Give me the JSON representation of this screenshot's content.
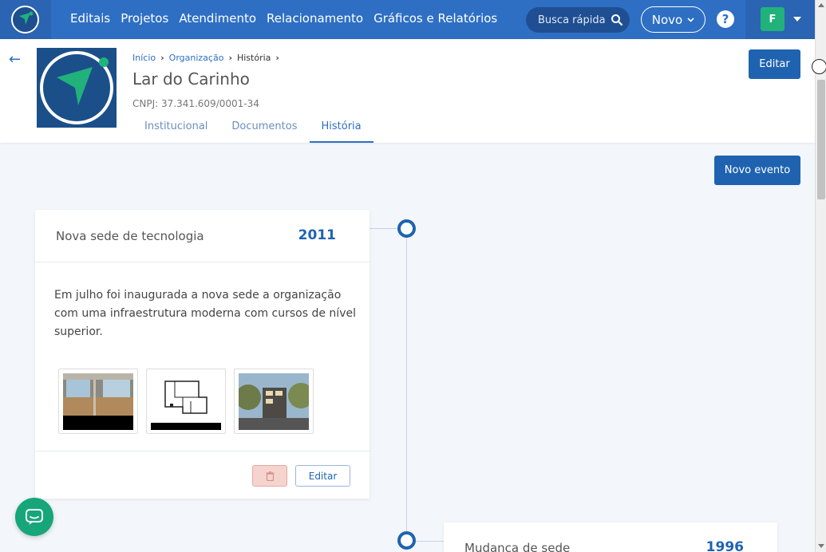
{
  "nav": {
    "links": [
      "Editais",
      "Projetos",
      "Atendimento",
      "Relacionamento",
      "Gráficos e Relatórios"
    ],
    "search_placeholder": "Busca rápida",
    "new_label": "Novo",
    "help_label": "?",
    "user_initial": "F"
  },
  "header": {
    "breadcrumb": [
      "Início",
      "Organização",
      "História"
    ],
    "title": "Lar do Carinho",
    "cnpj": "CNPJ: 37.341.609/0001-34",
    "tabs": [
      "Institucional",
      "Documentos",
      "História"
    ],
    "active_tab": "História",
    "edit_label": "Editar"
  },
  "actions": {
    "new_event_label": "Novo evento"
  },
  "events": [
    {
      "title": "Nova sede de tecnologia",
      "year": "2011",
      "description": "Em julho foi inaugurada a nova sede a organização com uma infraestrutura moderna com cursos de nível superior.",
      "edit_label": "Editar"
    },
    {
      "title": "Mudança de sede",
      "year": "1996"
    }
  ],
  "colors": {
    "primary": "#1f63b0",
    "navbar": "#2e6fc4",
    "accent_green": "#21b27b"
  }
}
